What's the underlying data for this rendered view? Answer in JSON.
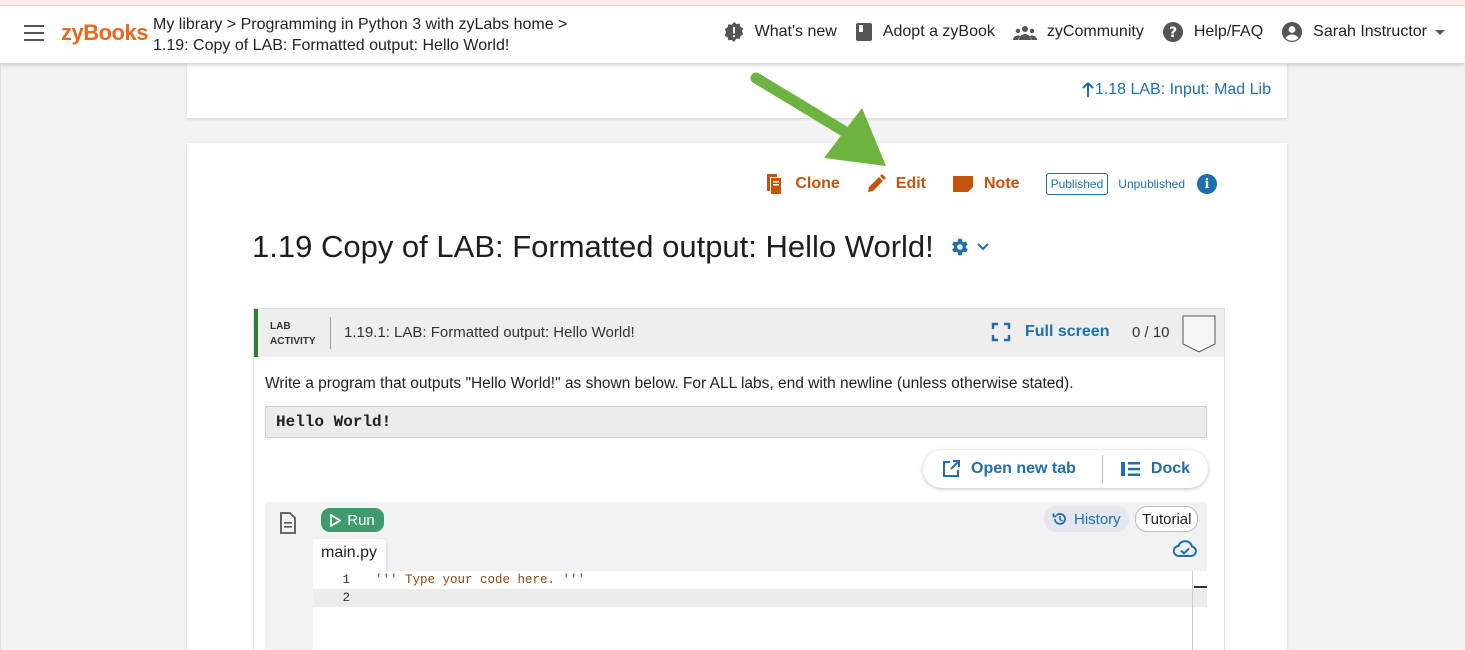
{
  "header": {
    "logo": "zyBooks",
    "breadcrumb_line1": "My library > Programming in Python 3 with zyLabs home >",
    "breadcrumb_line2": "1.19: Copy of LAB: Formatted output: Hello World!",
    "nav": {
      "whats_new": "What's new",
      "adopt": "Adopt a zyBook",
      "community": "zyCommunity",
      "help": "Help/FAQ",
      "user": "Sarah Instructor"
    }
  },
  "prev_section": {
    "label": "1.18 LAB: Input: Mad Lib"
  },
  "section": {
    "toolbar": {
      "clone": "Clone",
      "edit": "Edit",
      "note": "Note",
      "published": "Published",
      "unpublished": "Unpublished",
      "info": "i"
    },
    "title": "1.19 Copy of LAB: Formatted output: Hello World!"
  },
  "lab": {
    "tag_line1": "LAB",
    "tag_line2": "ACTIVITY",
    "name": "1.19.1: LAB: Formatted output: Hello World!",
    "full_screen": "Full screen",
    "score": "0 / 10",
    "description": "Write a program that outputs \"Hello World!\" as shown below. For ALL labs, end with newline (unless otherwise stated).",
    "expected_output": "Hello World!",
    "open_new_tab": "Open new tab",
    "dock": "Dock"
  },
  "ide": {
    "run": "Run",
    "history": "History",
    "tutorial": "Tutorial",
    "filename": "main.py",
    "lines": [
      {
        "num": "1",
        "code": "''' Type your code here. '''"
      },
      {
        "num": "2",
        "code": ""
      }
    ]
  },
  "colors": {
    "brand_orange": "#e56a1f",
    "tool_orange": "#c4530c",
    "link_blue": "#1d6fae",
    "run_green": "#3f9b6d",
    "lab_border_green": "#2e7d32",
    "arrow_green": "#6cb33f"
  },
  "icons": [
    "menu-icon",
    "whats-new-icon",
    "book-icon",
    "community-icon",
    "help-icon",
    "account-icon",
    "arrow-up-icon",
    "clone-icon",
    "edit-icon",
    "note-icon",
    "info-icon",
    "gear-icon",
    "chevron-down-icon",
    "fullscreen-icon",
    "open-new-tab-icon",
    "dock-icon",
    "file-icon",
    "play-icon",
    "history-icon",
    "cloud-sync-icon"
  ]
}
